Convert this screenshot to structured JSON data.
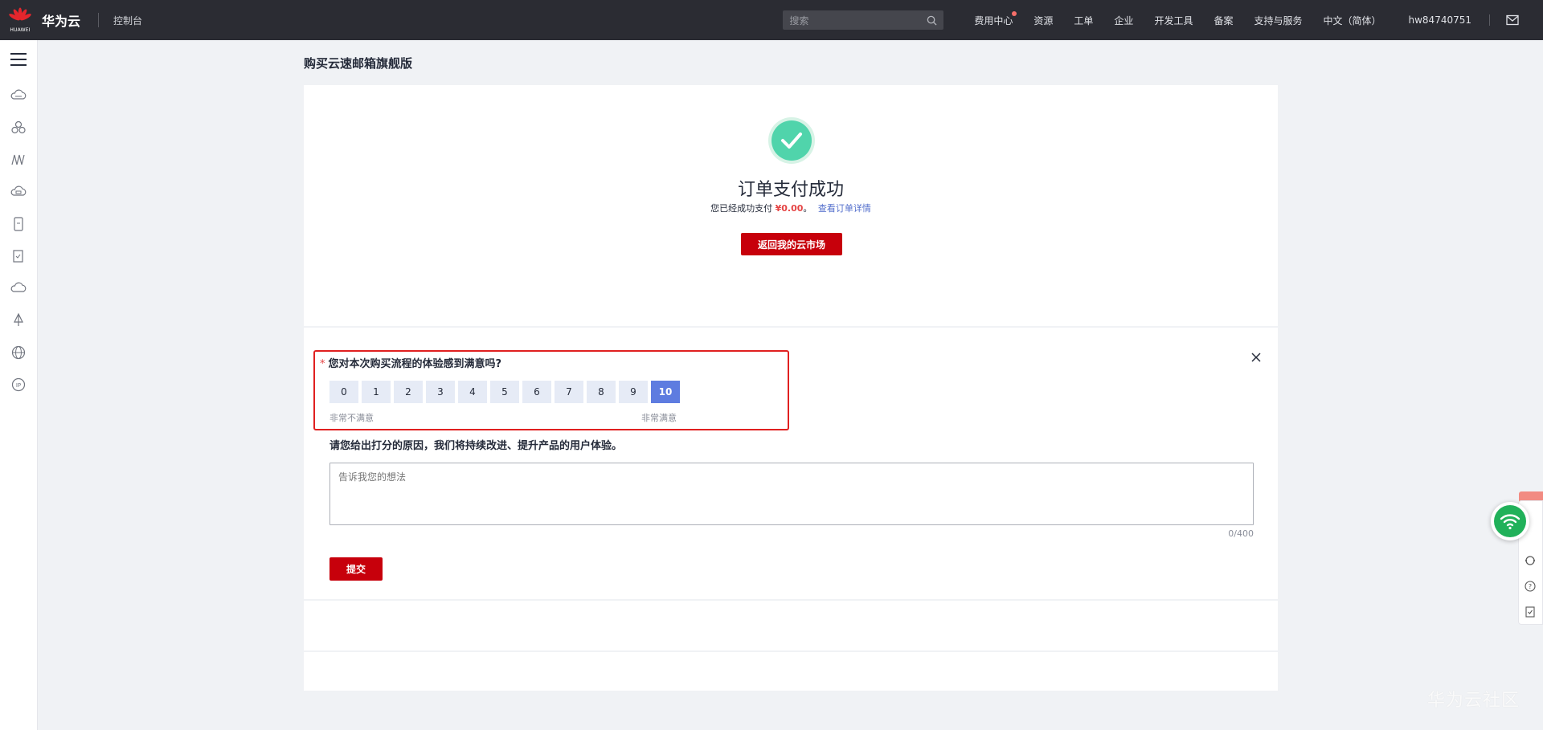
{
  "topbar": {
    "logo_text": "HUAWEI",
    "cloud_name": "华为云",
    "console": "控制台",
    "search_placeholder": "搜索",
    "nav": [
      "费用中心",
      "资源",
      "工单",
      "企业",
      "开发工具",
      "备案",
      "支持与服务",
      "中文（简体）"
    ],
    "username": "hw84740751",
    "brand_color": "#c7000b"
  },
  "page": {
    "title": "购买云速邮箱旗舰版"
  },
  "success": {
    "title": "订单支付成功",
    "sub_prefix": "您已经成功支付",
    "amount": "¥0.00",
    "sub_suffix": "。",
    "detail_link": "查看订单详情",
    "back_button": "返回我的云市场"
  },
  "survey": {
    "required_mark": "*",
    "question": "您对本次购买流程的体验感到满意吗?",
    "scores": [
      "0",
      "1",
      "2",
      "3",
      "4",
      "5",
      "6",
      "7",
      "8",
      "9",
      "10"
    ],
    "selected_score": "10",
    "scale_low": "非常不满意",
    "scale_high": "非常满意",
    "reason_label": "请您给出打分的原因，我们将持续改进、提升产品的用户体验。",
    "textarea_placeholder": "告诉我您的想法",
    "counter": "0/400",
    "submit": "提交"
  },
  "watermark": "华为云社区"
}
